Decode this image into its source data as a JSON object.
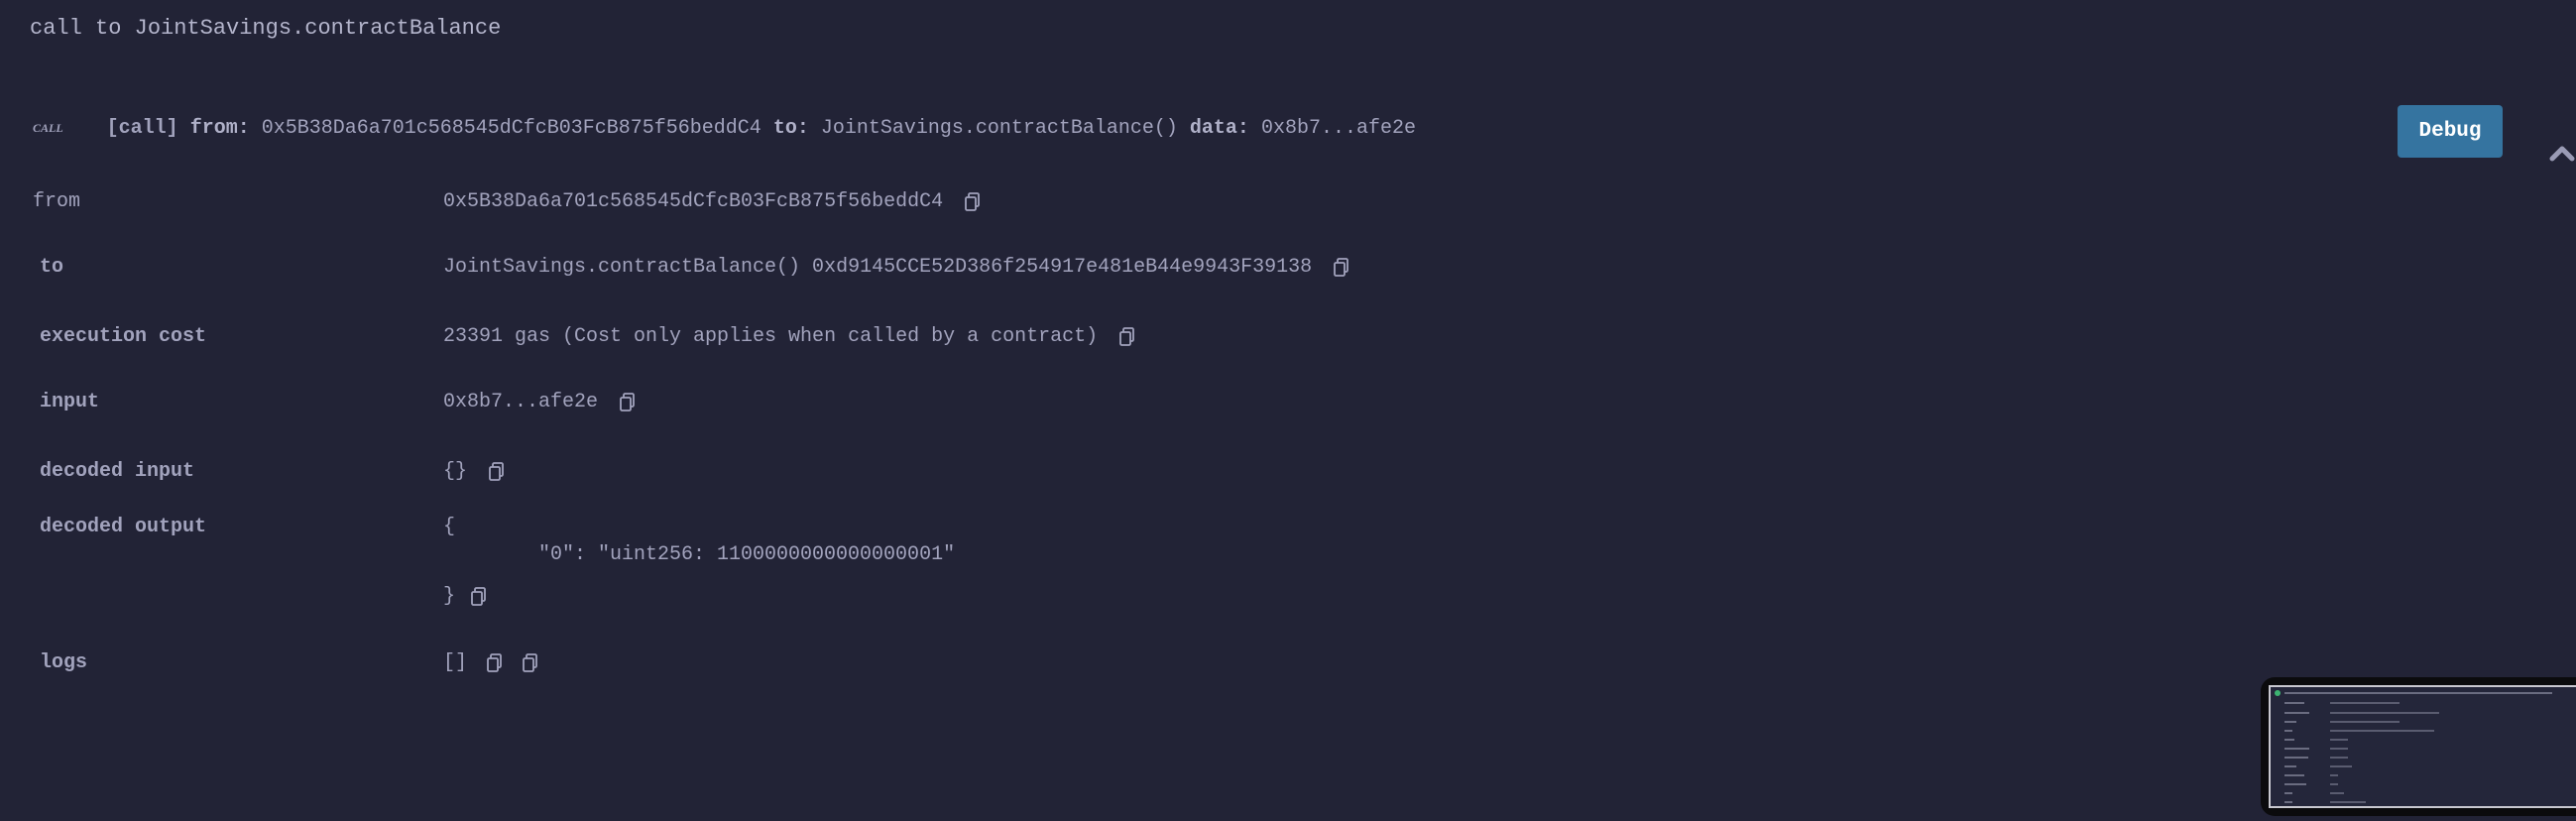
{
  "title": "call to JointSavings.contractBalance",
  "header": {
    "tag": "CALL",
    "kind": "[call]",
    "from_label": "from:",
    "from_value": "0x5B38Da6a701c568545dCfcB03FcB875f56beddC4",
    "to_label": "to:",
    "to_value": "JointSavings.contractBalance()",
    "data_label": "data:",
    "data_value": "0x8b7...afe2e",
    "debug_label": "Debug"
  },
  "rows": {
    "from": {
      "label": "from",
      "value": "0x5B38Da6a701c568545dCfcB03FcB875f56beddC4"
    },
    "to": {
      "label": "to",
      "value": "JointSavings.contractBalance() 0xd9145CCE52D386f254917e481eB44e9943F39138"
    },
    "execution_cost": {
      "label": "execution cost",
      "value": "23391 gas (Cost only applies when called by a contract)"
    },
    "input": {
      "label": "input",
      "value": "0x8b7...afe2e"
    },
    "decoded_input": {
      "label": "decoded input",
      "value": "{}"
    },
    "decoded_output": {
      "label": "decoded output",
      "open": "{",
      "line": "\"0\": \"uint256: 1100000000000000001\"",
      "close": "}"
    },
    "logs": {
      "label": "logs",
      "value": "[]"
    }
  },
  "colors": {
    "background": "#222336",
    "text": "#a2a3bd",
    "debug_button": "#3574a0"
  }
}
